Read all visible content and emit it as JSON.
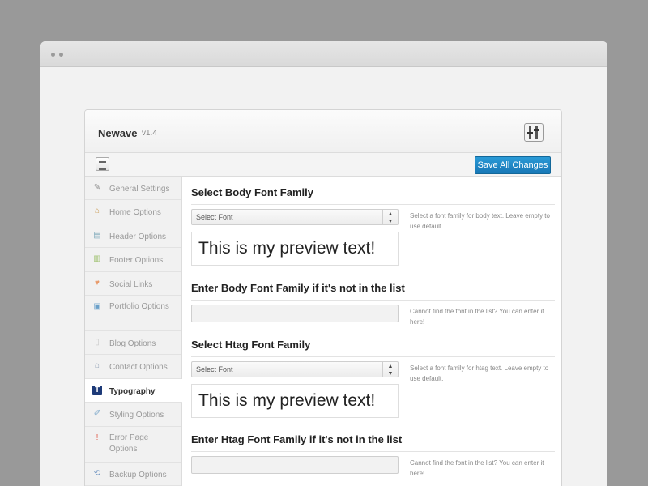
{
  "app": {
    "name": "Newave",
    "version": "v1.4"
  },
  "toolbar": {
    "save_label": "Save All Changes"
  },
  "sidebar": {
    "items": [
      {
        "label": "General Settings",
        "icon": "wrench-icon",
        "glyph": "✎",
        "color": "#8a8a8a"
      },
      {
        "label": "Home Options",
        "icon": "home-icon",
        "glyph": "⌂",
        "color": "#c99a52"
      },
      {
        "label": "Header Options",
        "icon": "header-icon",
        "glyph": "▤",
        "color": "#7aa6b8"
      },
      {
        "label": "Footer Options",
        "icon": "footer-icon",
        "glyph": "▥",
        "color": "#9bbf6a"
      },
      {
        "label": "Social Links",
        "icon": "heart-icon",
        "glyph": "♥",
        "color": "#e89a6a"
      },
      {
        "label": "Portfolio Options",
        "icon": "image-icon",
        "glyph": "▣",
        "color": "#6aa0c9"
      },
      {
        "label": "Blog Options",
        "icon": "page-icon",
        "glyph": "▯",
        "color": "#c8c8c8"
      },
      {
        "label": "Contact Options",
        "icon": "house-icon",
        "glyph": "⌂",
        "color": "#8a9bb0"
      },
      {
        "label": "Typography",
        "icon": "typography-icon",
        "glyph": "T",
        "color": "#1d3a78",
        "active": true
      },
      {
        "label": "Styling Options",
        "icon": "brush-icon",
        "glyph": "✐",
        "color": "#7aa6c9"
      },
      {
        "label": "Error Page Options",
        "icon": "error-icon",
        "glyph": "!",
        "color": "#e06050"
      },
      {
        "label": "Backup Options",
        "icon": "backup-icon",
        "glyph": "⟲",
        "color": "#6a90c0"
      }
    ]
  },
  "main": {
    "body_select": {
      "title": "Select Body Font Family",
      "value": "Select Font",
      "preview": "This is my preview text!",
      "description": "Select a font family for body text. Leave empty to use default."
    },
    "body_input": {
      "title": "Enter Body Font Family if it's not in the list",
      "value": "",
      "description": "Cannot find the font in the list? You can enter it here!"
    },
    "htag_select": {
      "title": "Select Htag Font Family",
      "value": "Select Font",
      "preview": "This is my preview text!",
      "description": "Select a font family for htag text. Leave empty to use default."
    },
    "htag_input": {
      "title": "Enter Htag Font Family if it's not in the list",
      "value": "",
      "description": "Cannot find the font in the list? You can enter it here!"
    }
  },
  "colors": {
    "accent": "#1d88c9",
    "active_icon": "#1d3a78"
  }
}
